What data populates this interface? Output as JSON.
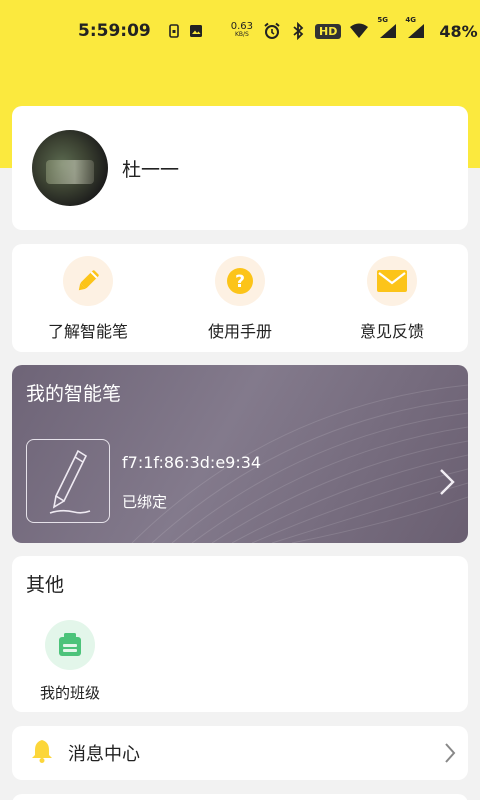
{
  "status_bar": {
    "time": "5:59:09",
    "net_speed_value": "0.63",
    "net_speed_unit": "KB/S",
    "hd_label": "HD",
    "hd_sub": "1 2",
    "signal_5g": "5G",
    "signal_4g": "4G",
    "battery_percent": "48%"
  },
  "profile": {
    "username": "杜一一"
  },
  "quick_actions": [
    {
      "label": "了解智能笔",
      "icon": "pencil-icon"
    },
    {
      "label": "使用手册",
      "icon": "question-icon"
    },
    {
      "label": "意见反馈",
      "icon": "mail-icon"
    }
  ],
  "pen_card": {
    "title": "我的智能笔",
    "mac": "f7:1f:86:3d:e9:34",
    "status": "已绑定"
  },
  "other": {
    "title": "其他",
    "items": [
      {
        "label": "我的班级",
        "icon": "class-icon"
      }
    ]
  },
  "message_center": {
    "label": "消息中心",
    "icon": "bell-icon"
  },
  "colors": {
    "header_yellow": "#fbe93e",
    "accent_yellow": "#fcc419",
    "pen_card_bg": "#7a7083",
    "class_green": "#4cc37a"
  }
}
